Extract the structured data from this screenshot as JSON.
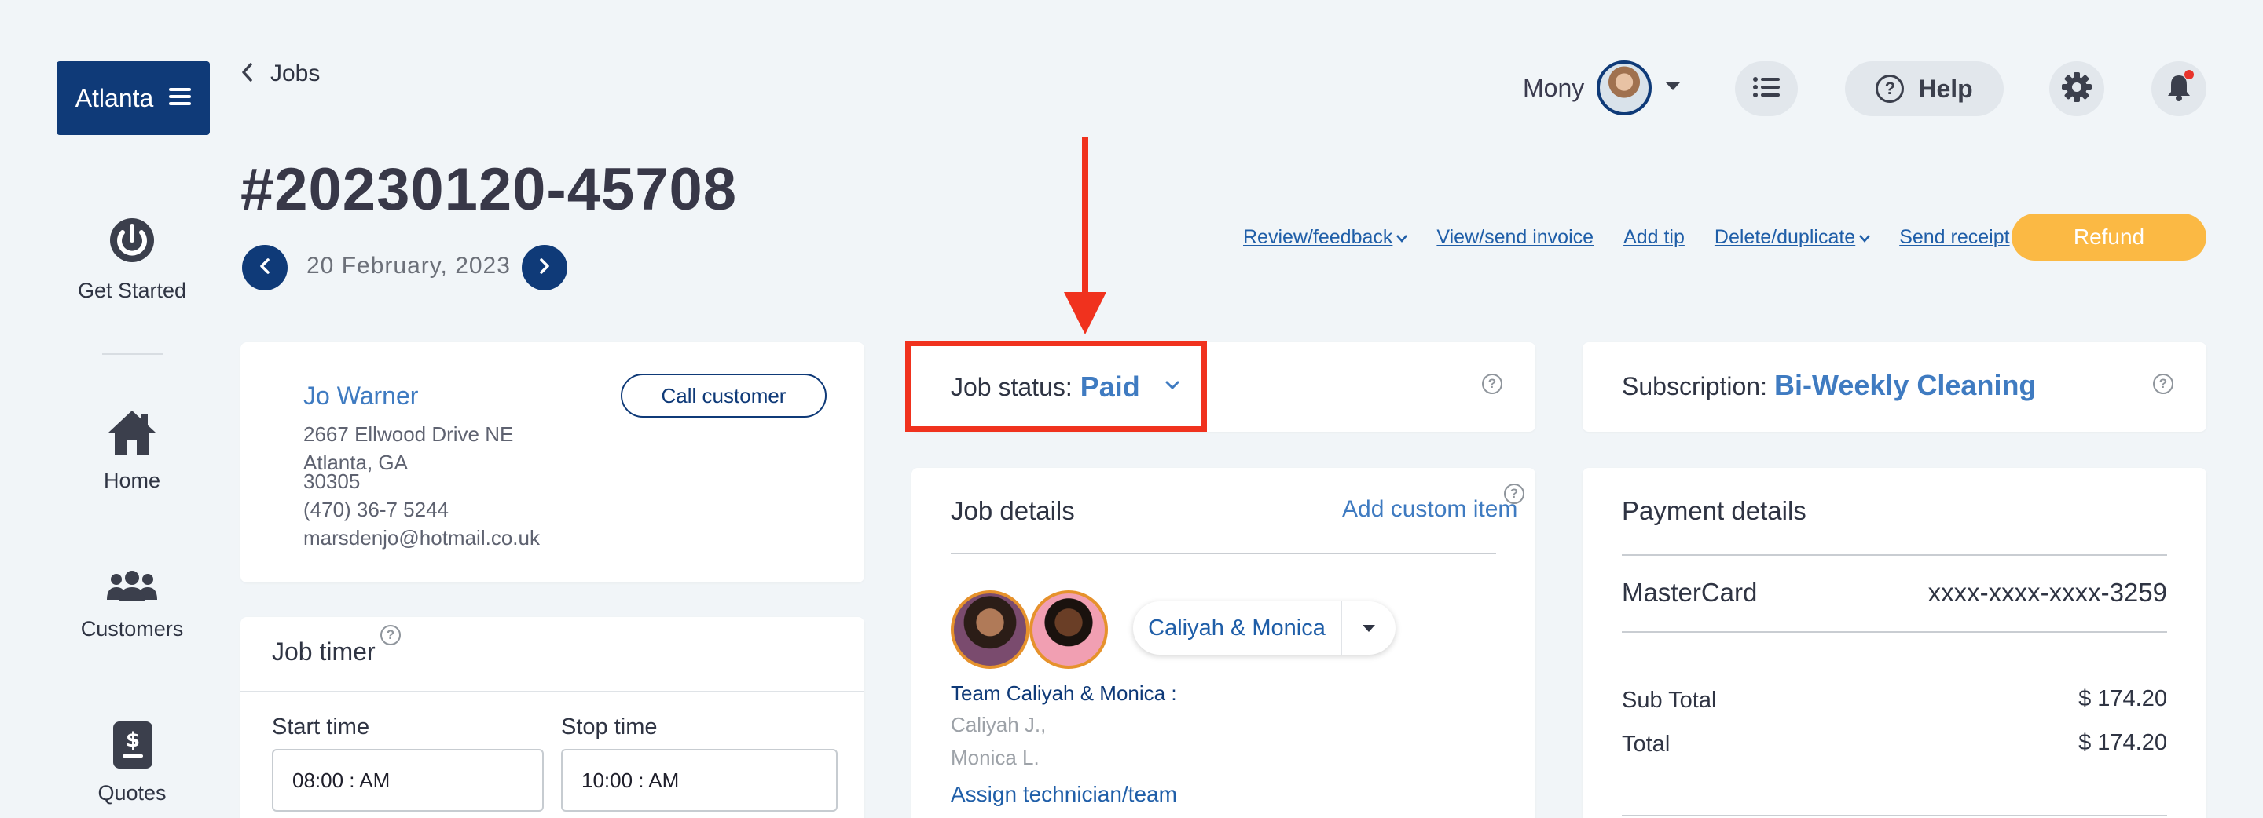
{
  "sidebar": {
    "brand_label": "Atlanta",
    "items": [
      {
        "label": "Get Started",
        "icon": "power-icon"
      },
      {
        "label": "Home",
        "icon": "home-icon"
      },
      {
        "label": "Customers",
        "icon": "users-icon"
      },
      {
        "label": "Quotes",
        "icon": "quote-dollar-icon"
      }
    ]
  },
  "header": {
    "back_label": "Jobs",
    "user_name": "Mony",
    "help_label": "Help"
  },
  "job": {
    "number": "#20230120-45708",
    "date": "20 February, 2023"
  },
  "actions": {
    "review_feedback": "Review/feedback",
    "view_send_invoice": "View/send invoice",
    "add_tip": "Add tip",
    "delete_duplicate": "Delete/duplicate",
    "send_receipt": "Send receipt",
    "refund": "Refund"
  },
  "customer": {
    "name": "Jo Warner",
    "call_button": "Call customer",
    "address_line1": "2667 Ellwood Drive NE",
    "address_line2": "Atlanta, GA",
    "zip": "30305",
    "phone": "(470) 36-7 5244",
    "email": "marsdenjo@hotmail.co.uk"
  },
  "job_timer": {
    "title": "Job timer",
    "start_label": "Start time",
    "start_value": "08:00 : AM",
    "stop_label": "Stop time",
    "stop_value": "10:00 : AM"
  },
  "job_status": {
    "label": "Job status:",
    "value": "Paid"
  },
  "job_details": {
    "title": "Job details",
    "add_custom_item": "Add custom item",
    "team_select": "Caliyah & Monica",
    "team_heading": "Team Caliyah & Monica :",
    "members": [
      "Caliyah J.,",
      "Monica L."
    ],
    "assign_link": "Assign technician/team"
  },
  "subscription": {
    "label": "Subscription:",
    "value": "Bi-Weekly Cleaning"
  },
  "payment": {
    "title": "Payment details",
    "card_type": "MasterCard",
    "card_number": "xxxx-xxxx-xxxx-3259",
    "subtotal_label": "Sub Total",
    "subtotal_value": "$ 174.20",
    "total_label": "Total",
    "total_value": "$ 174.20"
  },
  "colors": {
    "navy": "#0f3a78",
    "accent_blue": "#3f7bc1",
    "refund_orange": "#fbb944",
    "annotation_red": "#f0321e",
    "background": "#f1f5f8"
  }
}
